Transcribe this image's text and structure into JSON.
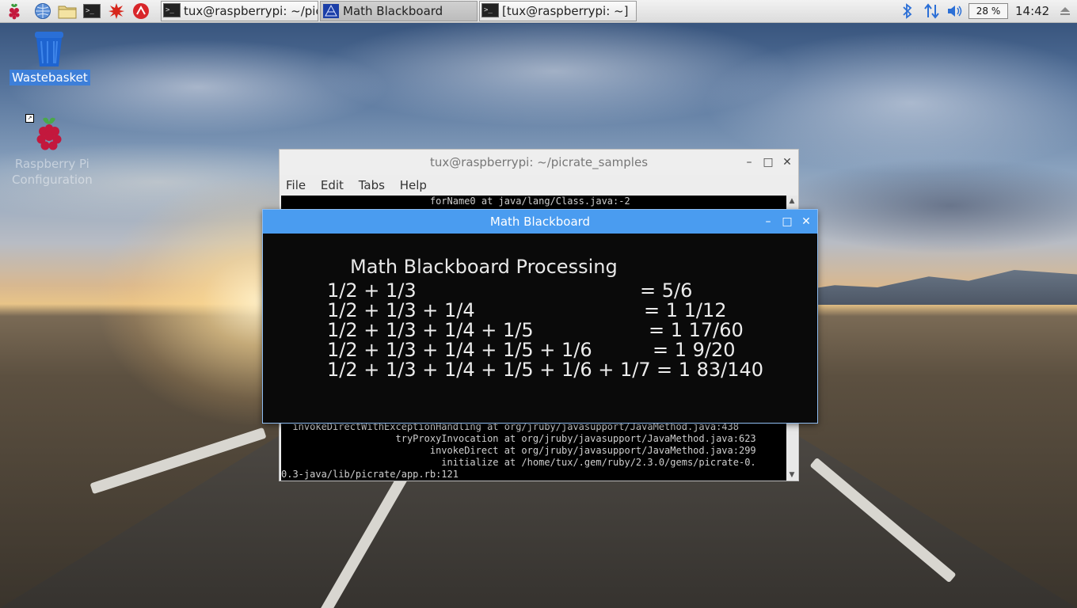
{
  "taskbar": {
    "launchers": [
      {
        "icon": "raspberry-menu-icon"
      },
      {
        "icon": "web-browser-icon"
      },
      {
        "icon": "file-manager-icon"
      },
      {
        "icon": "terminal-icon"
      },
      {
        "icon": "math-kernel-icon"
      },
      {
        "icon": "wolfram-icon"
      }
    ],
    "tasks": [
      {
        "label": "tux@raspberrypi: ~/pic...",
        "icon": "terminal-icon",
        "active": false
      },
      {
        "label": "Math Blackboard",
        "icon": "processing-icon",
        "active": true
      },
      {
        "label": "[tux@raspberrypi: ~]",
        "icon": "terminal-icon",
        "active": false
      }
    ],
    "tray": {
      "bluetooth": "bluetooth-icon",
      "network": "network-arrows-icon",
      "volume": "volume-icon",
      "cpu": "28 %",
      "clock": "14:42",
      "eject": "eject-icon"
    },
    "colors": {
      "accent": "#4a9cf0"
    }
  },
  "desktop": {
    "icons": [
      {
        "label": "Wastebasket",
        "icon": "wastebasket-icon",
        "selected": true
      },
      {
        "label": "Raspberry Pi Configuration",
        "label_line1": "Raspberry Pi",
        "label_line2": "Configuration",
        "icon": "raspberry-pi-icon",
        "selected": false
      }
    ]
  },
  "terminal": {
    "title": "tux@raspberrypi: ~/picrate_samples",
    "menu": [
      "File",
      "Edit",
      "Tabs",
      "Help"
    ],
    "lines_top": [
      "                          forName0 at java/lang/Class.java:-2"
    ],
    "lines_bottom": [
      "  invokeDirectWithExceptionHandling at org/jruby/javasupport/JavaMethod.java:438",
      "                    tryProxyInvocation at org/jruby/javasupport/JavaMethod.java:623",
      "                          invokeDirect at org/jruby/javasupport/JavaMethod.java:299",
      "                            initialize at /home/tux/.gem/ruby/2.3.0/gems/picrate-0.",
      "0.3-java/lib/picrate/app.rb:121"
    ]
  },
  "blackboard": {
    "title": "Math Blackboard",
    "heading": "Math Blackboard Processing",
    "rows": [
      {
        "expr": "1/2 + 1/3",
        "result": "= 5/6"
      },
      {
        "expr": "1/2 + 1/3 + 1/4",
        "result": "= 1 1/12"
      },
      {
        "expr": "1/2 + 1/3 + 1/4 + 1/5",
        "result": "= 1 17/60"
      },
      {
        "expr": "1/2 + 1/3 + 1/4 + 1/5 + 1/6",
        "result": "= 1 9/20"
      },
      {
        "expr": "1/2 + 1/3 + 1/4 + 1/5 + 1/6 + 1/7",
        "result": "= 1 83/140"
      }
    ]
  }
}
